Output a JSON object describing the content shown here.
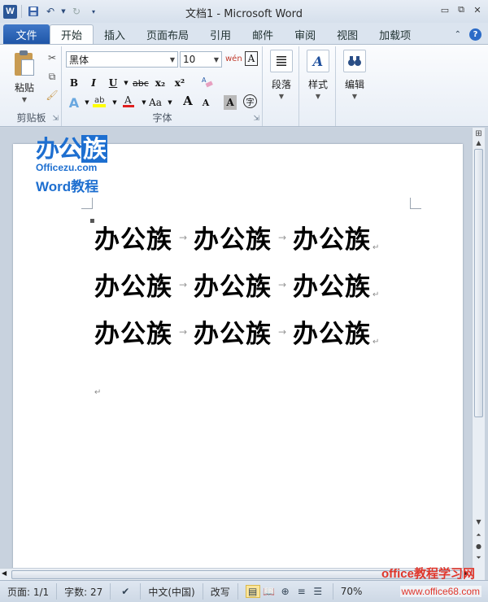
{
  "window": {
    "title": "文档1 - Microsoft Word"
  },
  "tabs": {
    "file": "文件",
    "items": [
      "开始",
      "插入",
      "页面布局",
      "引用",
      "邮件",
      "审阅",
      "视图",
      "加载项"
    ]
  },
  "ribbon": {
    "clipboard": {
      "paste": "粘贴",
      "label": "剪贴板"
    },
    "font": {
      "name": "黑体",
      "size": "10",
      "label": "字体",
      "bold": "B",
      "italic": "I",
      "underline": "U",
      "strike": "abc",
      "subscript": "x₂",
      "superscript": "x²",
      "font_color": "A",
      "change_case": "Aa",
      "grow": "A",
      "shrink": "A",
      "char_shading": "A",
      "enclose": "字",
      "phonetic": "wén",
      "border": "A"
    },
    "paragraph": {
      "label": "段落"
    },
    "styles": {
      "label": "样式"
    },
    "editing": {
      "label": "编辑"
    }
  },
  "document": {
    "logo": {
      "line1a": "办公",
      "line1b": "族",
      "line2": "Officezu.com",
      "line3": "Word教程"
    },
    "lines": [
      [
        "办公族",
        "办公族",
        "办公族"
      ],
      [
        "办公族",
        "办公族",
        "办公族"
      ],
      [
        "办公族",
        "办公族",
        "办公族"
      ]
    ],
    "tab_glyph": "→",
    "para_glyph": "↵"
  },
  "statusbar": {
    "page": "页面: 1/1",
    "words": "字数: 27",
    "language": "中文(中国)",
    "mode": "改写",
    "zoom": "70%"
  },
  "watermark": {
    "line1": "office教程学习网",
    "line2": "www.office68.com"
  },
  "colors": {
    "accent": "#2b5797",
    "logo_blue": "#1e6fd0",
    "watermark_red": "#e0362b"
  }
}
